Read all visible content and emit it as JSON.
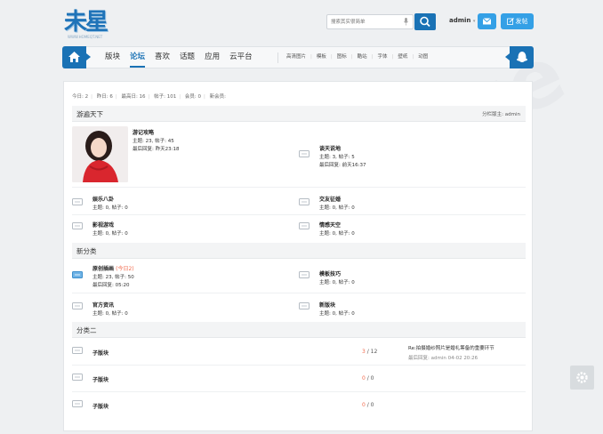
{
  "header": {
    "logo_text": "未星",
    "logo_sub": "WWW.HOMEQT.NET",
    "search_placeholder": "搜索其实很简单",
    "username": "admin",
    "user_caret": "▾",
    "post_button": "发帖"
  },
  "nav": {
    "main": [
      "版块",
      "论坛",
      "喜欢",
      "话题",
      "应用",
      "云平台"
    ],
    "active": "论坛",
    "sub": [
      "高清图片",
      "模板",
      "图标",
      "酷站",
      "字体",
      "壁纸",
      "动图"
    ]
  },
  "stats": {
    "today": "今日: 2",
    "yesterday": "昨日: 6",
    "max": "最高日: 16",
    "posts": "帖子: 101",
    "members": "会员: 0",
    "new_member": "新会员:"
  },
  "categories": [
    {
      "name": "游遍天下",
      "moderator": "分栏版主: admin",
      "forums": [
        {
          "name": "游记攻略",
          "topics_posts": "主题: 23, 帖子: 45",
          "last": "最后回复: 昨天23:18"
        },
        {
          "name": "谈天说地",
          "topics_posts": "主题: 3, 帖子: 5",
          "last": "最后回复: 前天16:37"
        },
        {
          "name": "娱乐八卦",
          "topics_posts": "主题: 0, 帖子: 0"
        },
        {
          "name": "交友征婚",
          "topics_posts": "主题: 0, 帖子: 0"
        },
        {
          "name": "影视游戏",
          "topics_posts": "主题: 0, 帖子: 0"
        },
        {
          "name": "情感天空",
          "topics_posts": "主题: 0, 帖子: 0"
        }
      ]
    },
    {
      "name": "新分类",
      "forums": [
        {
          "name": "原创插画",
          "new": "(今日2)",
          "topics_posts": "主题: 23, 帖子: 50",
          "last": "最后回复: 05:20"
        },
        {
          "name": "模板技巧",
          "topics_posts": "主题: 0, 帖子: 0"
        },
        {
          "name": "官方资讯",
          "topics_posts": "主题: 0, 帖子: 0"
        },
        {
          "name": "新版块",
          "topics_posts": "主题: 0, 帖子: 0"
        }
      ]
    },
    {
      "name": "分类二",
      "forums": [
        {
          "name": "子版块",
          "hot": "3",
          "total": "/ 12",
          "last_title": "Re:拍摄婚纱照片是婚礼筹备的重要环节",
          "last_meta": "最后回复: admin 04-02 20:26"
        },
        {
          "name": "子版块",
          "hot": "0",
          "total": "/ 0"
        },
        {
          "name": "子版块",
          "hot": "0",
          "total": "/ 0"
        }
      ]
    }
  ],
  "colors": {
    "accent": "#1a72b5",
    "button": "#34a0e6",
    "highlight": "#f26c4f"
  }
}
